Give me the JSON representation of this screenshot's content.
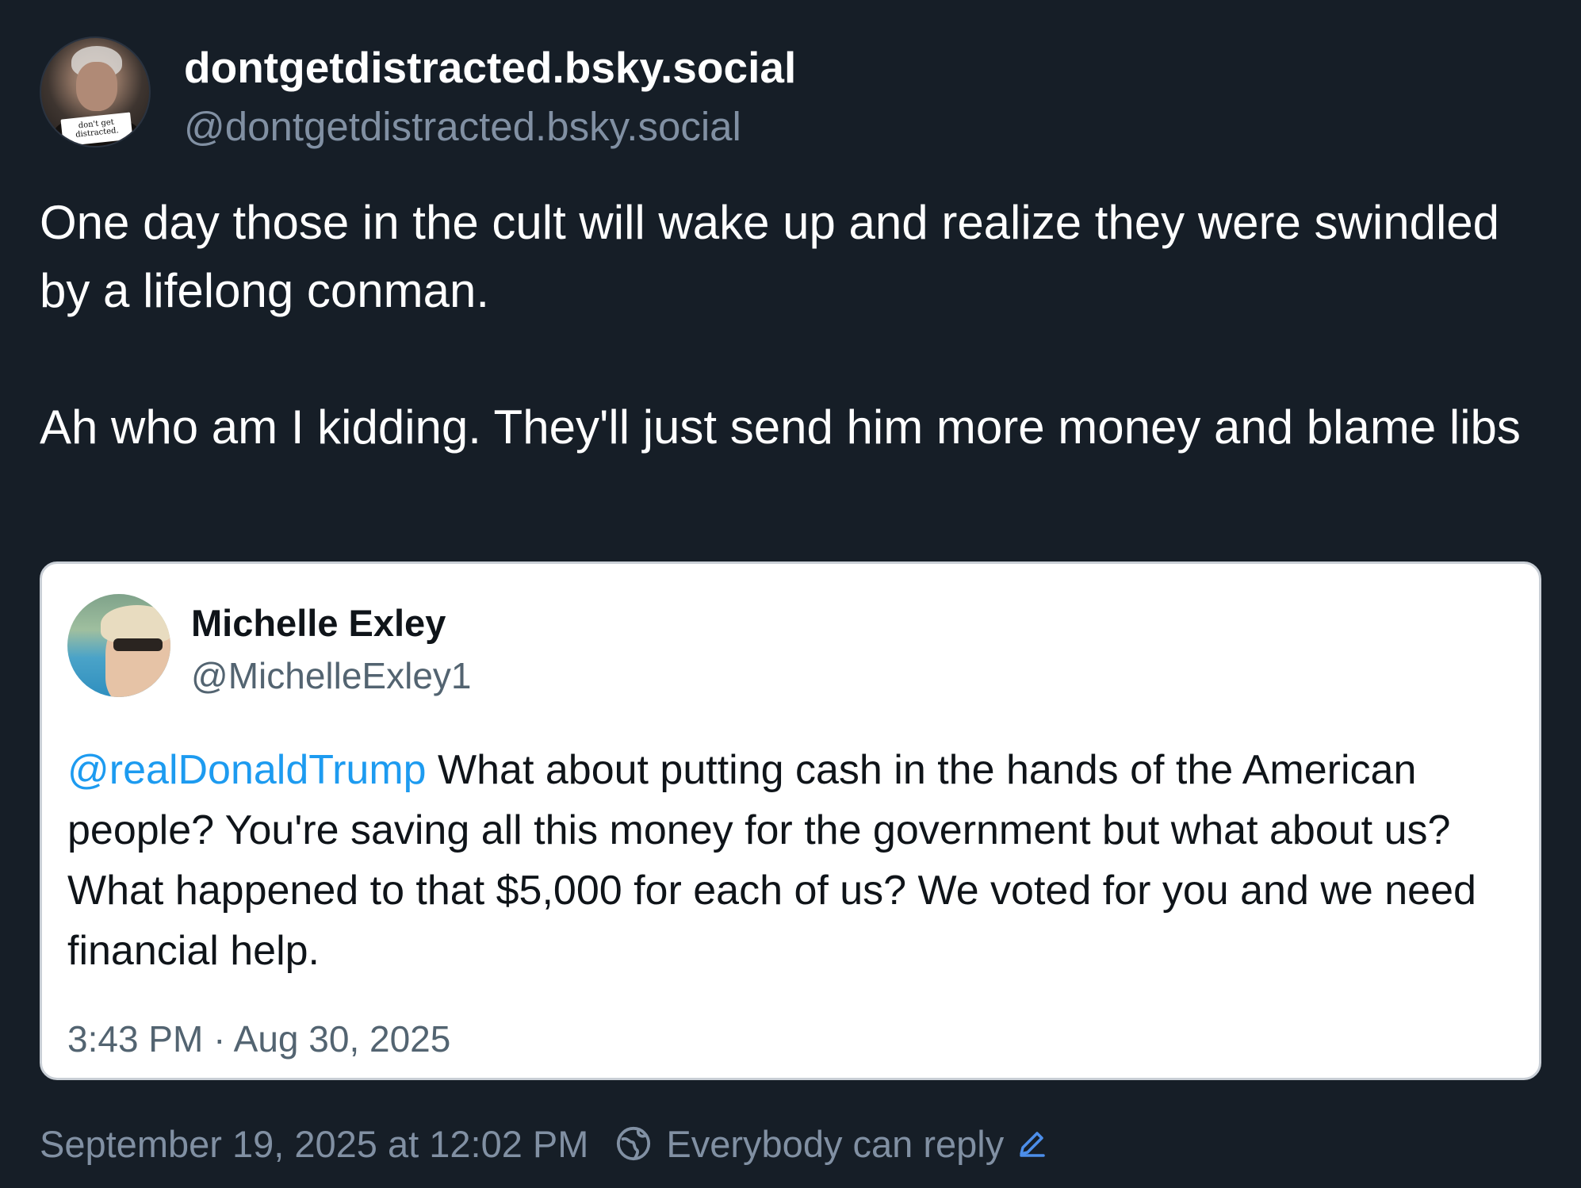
{
  "author": {
    "display_name": "dontgetdistracted.bsky.social",
    "handle": "@dontgetdistracted.bsky.social",
    "avatar_text": "don't get distracted."
  },
  "post": {
    "paragraph1": "One day those in the cult will wake up and realize they were swindled by a lifelong conman.",
    "paragraph2": "Ah who am I kidding. They'll just send him more money and blame libs"
  },
  "embed": {
    "display_name": "Michelle Exley",
    "handle": "@MichelleExley1",
    "mention": "@realDonaldTrump",
    "text": " What about putting cash in the hands of the American people? You're saving all this money for the government but what about us? What happened to that $5,000 for each of us? We voted for you and we need financial help.",
    "timestamp": "3:43 PM · Aug 30, 2025"
  },
  "footer": {
    "timestamp": "September 19, 2025 at 12:02 PM",
    "reply_setting": "Everybody can reply",
    "globe_icon": "globe-icon",
    "edit_icon": "pencil-icon",
    "accent_color": "#4c8eea"
  }
}
